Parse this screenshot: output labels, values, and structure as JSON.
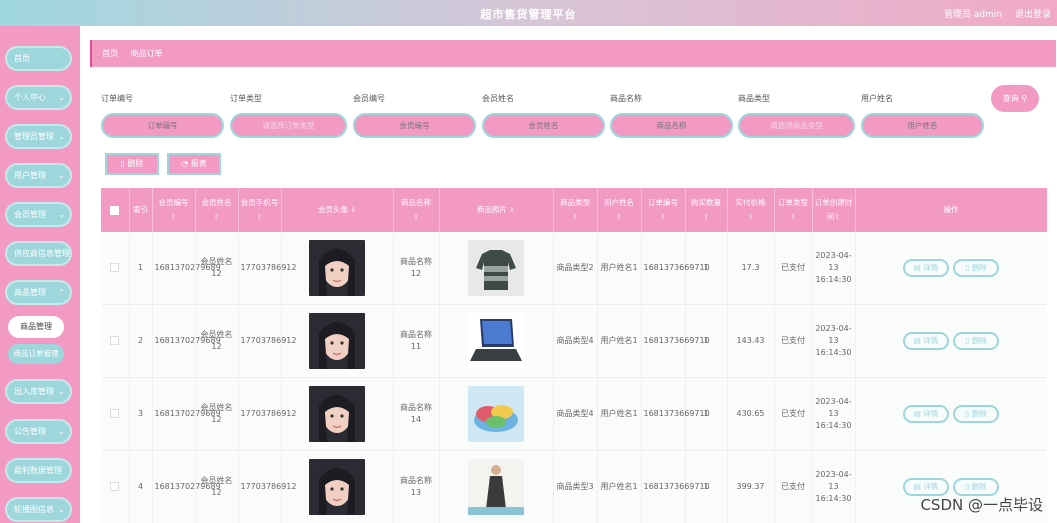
{
  "header": {
    "title": "超市售货管理平台",
    "admin_label": "管理员 admin",
    "logout": "退出登录"
  },
  "sidebar": {
    "items": [
      {
        "label": "首页",
        "has_chevron": false
      },
      {
        "label": "个人中心",
        "has_chevron": true
      },
      {
        "label": "管理员管理",
        "has_chevron": true
      },
      {
        "label": "用户管理",
        "has_chevron": true
      },
      {
        "label": "会员管理",
        "has_chevron": true
      },
      {
        "label": "供应商信息管理",
        "has_chevron": false
      },
      {
        "label": "商品管理",
        "has_chevron": true
      }
    ],
    "sub_items": [
      {
        "label": "商品管理"
      },
      {
        "label": "商品订单管理"
      }
    ],
    "items_after": [
      {
        "label": "出入库管理",
        "has_chevron": true
      },
      {
        "label": "公告管理",
        "has_chevron": true
      },
      {
        "label": "盈利数据管理",
        "has_chevron": false
      },
      {
        "label": "轮播图信息",
        "has_chevron": true
      }
    ]
  },
  "breadcrumb": {
    "home": "首页",
    "current": "商品订单"
  },
  "filters": [
    {
      "label": "订单编号",
      "placeholder": "订单编号"
    },
    {
      "label": "订单类型",
      "placeholder": "请选择订单类型"
    },
    {
      "label": "会员编号",
      "placeholder": "会员编号"
    },
    {
      "label": "会员姓名",
      "placeholder": "会员姓名"
    },
    {
      "label": "商品名称",
      "placeholder": "商品名称"
    },
    {
      "label": "商品类型",
      "placeholder": "请选择商品类型"
    },
    {
      "label": "用户姓名",
      "placeholder": "用户姓名"
    }
  ],
  "query_button": "查询",
  "actions": {
    "delete": "删除",
    "report": "报表"
  },
  "table": {
    "columns": [
      "索引",
      "会员编号",
      "会员姓名",
      "会员手机号",
      "会员头像",
      "商品名称",
      "商品照片",
      "商品类型",
      "用户姓名",
      "订单编号",
      "购买数量",
      "实付价格",
      "订单类型",
      "订单创建时间",
      "操作"
    ],
    "rows": [
      {
        "index": "1",
        "member_no": "1681370279689",
        "member_name": "会员姓名12",
        "phone": "17703786912",
        "product_name": "商品名称12",
        "product_type": "商品类型2",
        "user_name": "用户姓名1",
        "order_no": "1681373669710",
        "qty": "1",
        "price": "17.3",
        "order_type": "已支付",
        "created": "2023-04-13 16:14:30",
        "product_photo": "sweater"
      },
      {
        "index": "2",
        "member_no": "1681370279689",
        "member_name": "会员姓名12",
        "phone": "17703786912",
        "product_name": "商品名称11",
        "product_type": "商品类型4",
        "user_name": "用户姓名1",
        "order_no": "1681373669710",
        "qty": "1",
        "price": "143.43",
        "order_type": "已支付",
        "created": "2023-04-13 16:14:30",
        "product_photo": "laptop"
      },
      {
        "index": "3",
        "member_no": "1681370279689",
        "member_name": "会员姓名12",
        "phone": "17703786912",
        "product_name": "商品名称14",
        "product_type": "商品类型4",
        "user_name": "用户姓名1",
        "order_no": "1681373669710",
        "qty": "1",
        "price": "430.65",
        "order_type": "已支付",
        "created": "2023-04-13 16:14:30",
        "product_photo": "bowls"
      },
      {
        "index": "4",
        "member_no": "1681370279689",
        "member_name": "会员姓名12",
        "phone": "17703786912",
        "product_name": "商品名称13",
        "product_type": "商品类型3",
        "user_name": "用户姓名1",
        "order_no": "1681373669710",
        "qty": "1",
        "price": "399.37",
        "order_type": "已支付",
        "created": "2023-04-13 16:14:30",
        "product_photo": "dress"
      }
    ],
    "op_detail": "详情",
    "op_delete": "删除"
  },
  "watermark": "CSDN @一点毕设",
  "colors": {
    "pink": "#f29ac4",
    "teal": "#9dd6db"
  }
}
